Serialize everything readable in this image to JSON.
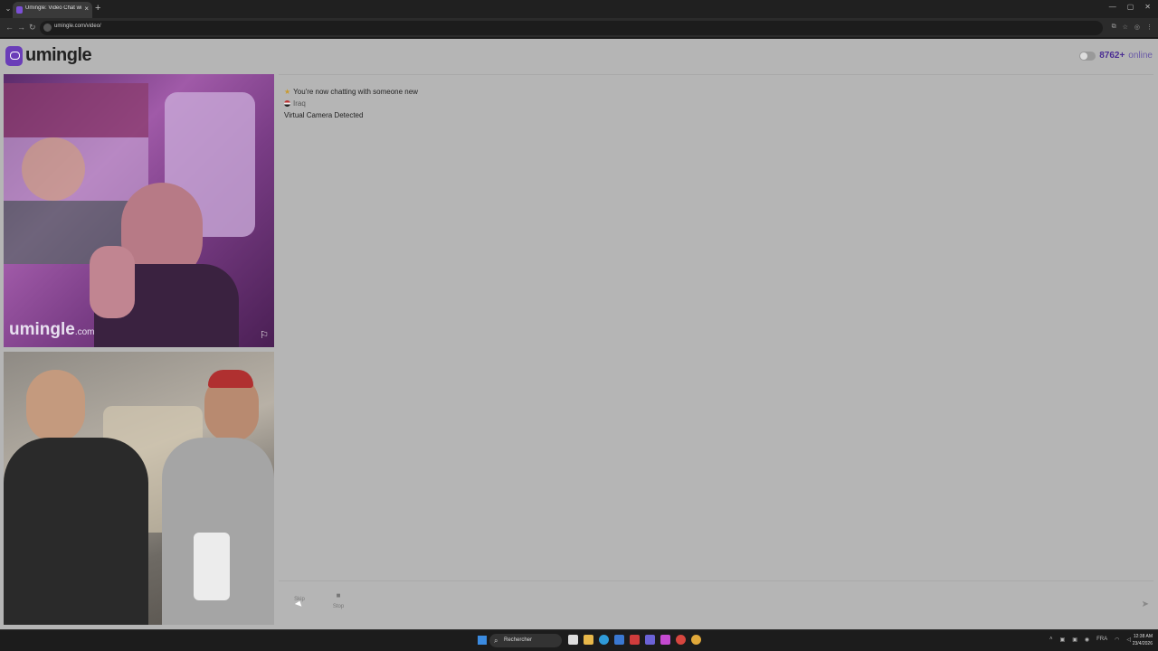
{
  "browser": {
    "tab_title": "Umingle: Video Chat with S",
    "tab_close": "×",
    "new_tab": "+",
    "url": "umingle.com/video/",
    "window_controls": [
      "—",
      "▢",
      "✕"
    ]
  },
  "site": {
    "brand": "umingle",
    "online_count": "8762+",
    "online_label": "online"
  },
  "video": {
    "watermark": "umingle",
    "watermark_suffix": ".com"
  },
  "chat": {
    "messages": [
      "You're now chatting with someone new",
      "Iraq",
      "Virtual Camera Detected"
    ]
  },
  "controls": {
    "skip_label": "Skip",
    "stop_label": "Stop",
    "stop_icon": "■",
    "send_icon": "➤"
  },
  "taskbar": {
    "search_placeholder": "Rechercher",
    "tray_lang": "FRA",
    "time": "12:38 AM",
    "date": "23/4/2026"
  },
  "icons": {
    "accent": "#6a3db8",
    "online_color": "#4b2d93"
  }
}
